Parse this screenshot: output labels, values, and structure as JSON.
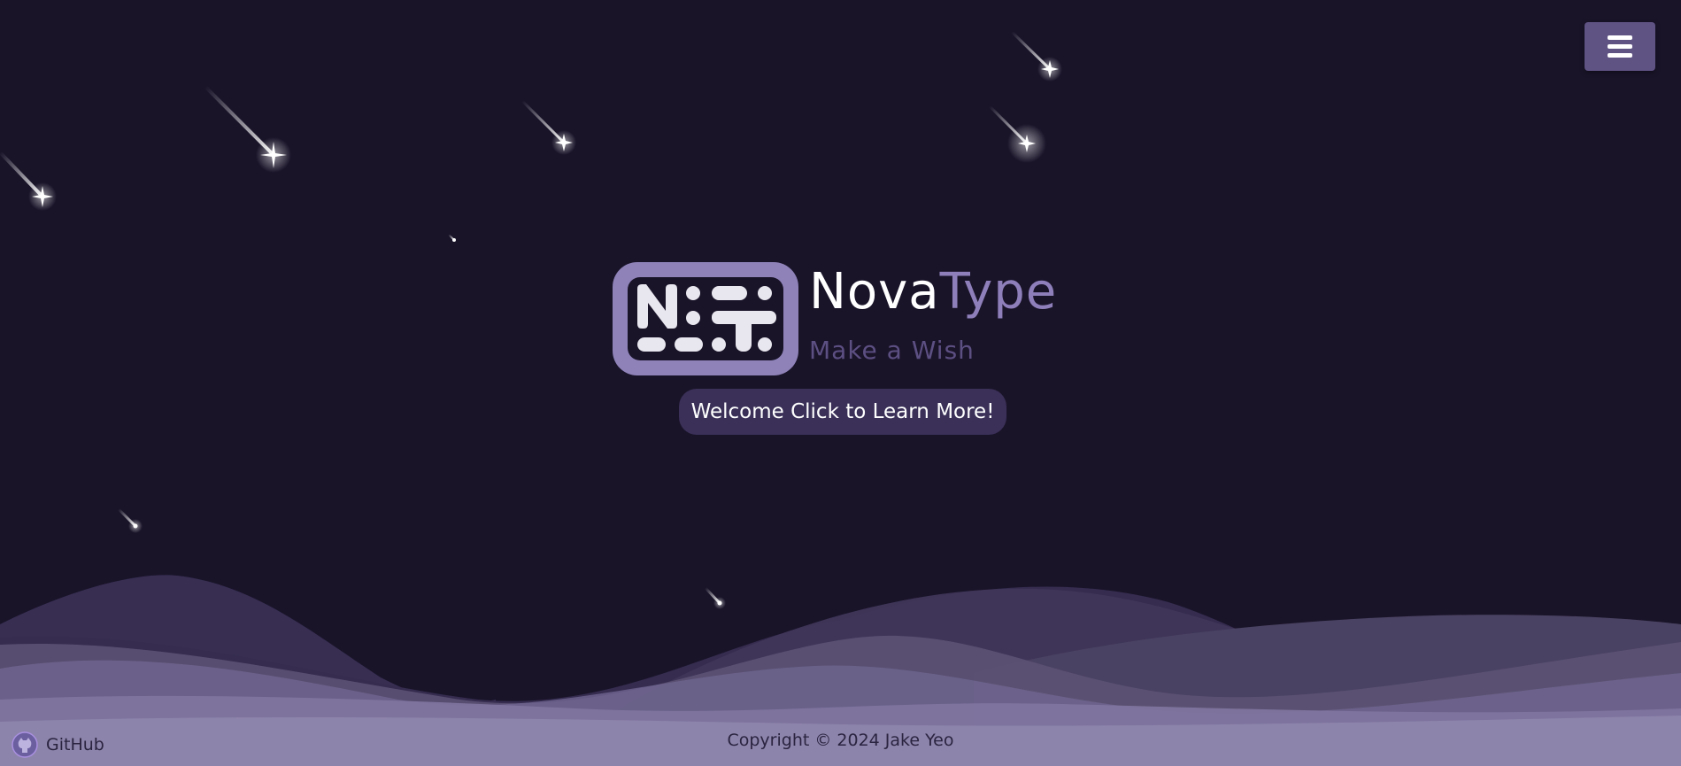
{
  "header": {
    "menu_icon": "hamburger-icon"
  },
  "brand": {
    "logo_icon": "novatype-logo-icon",
    "title_part1": "Nova",
    "title_part2": "Type",
    "tagline": "Make a Wish"
  },
  "cta": {
    "label": "Welcome Click to Learn More!"
  },
  "footer": {
    "github_icon": "github-icon",
    "github_label": "GitHub",
    "copyright": "Copyright © 2024 Jake Yeo"
  },
  "colors": {
    "background": "#1a1429",
    "accent": "#8e7fba",
    "menu_button": "#5f5384",
    "cta_background": "#3a3058",
    "tagline": "#5c4f82"
  }
}
